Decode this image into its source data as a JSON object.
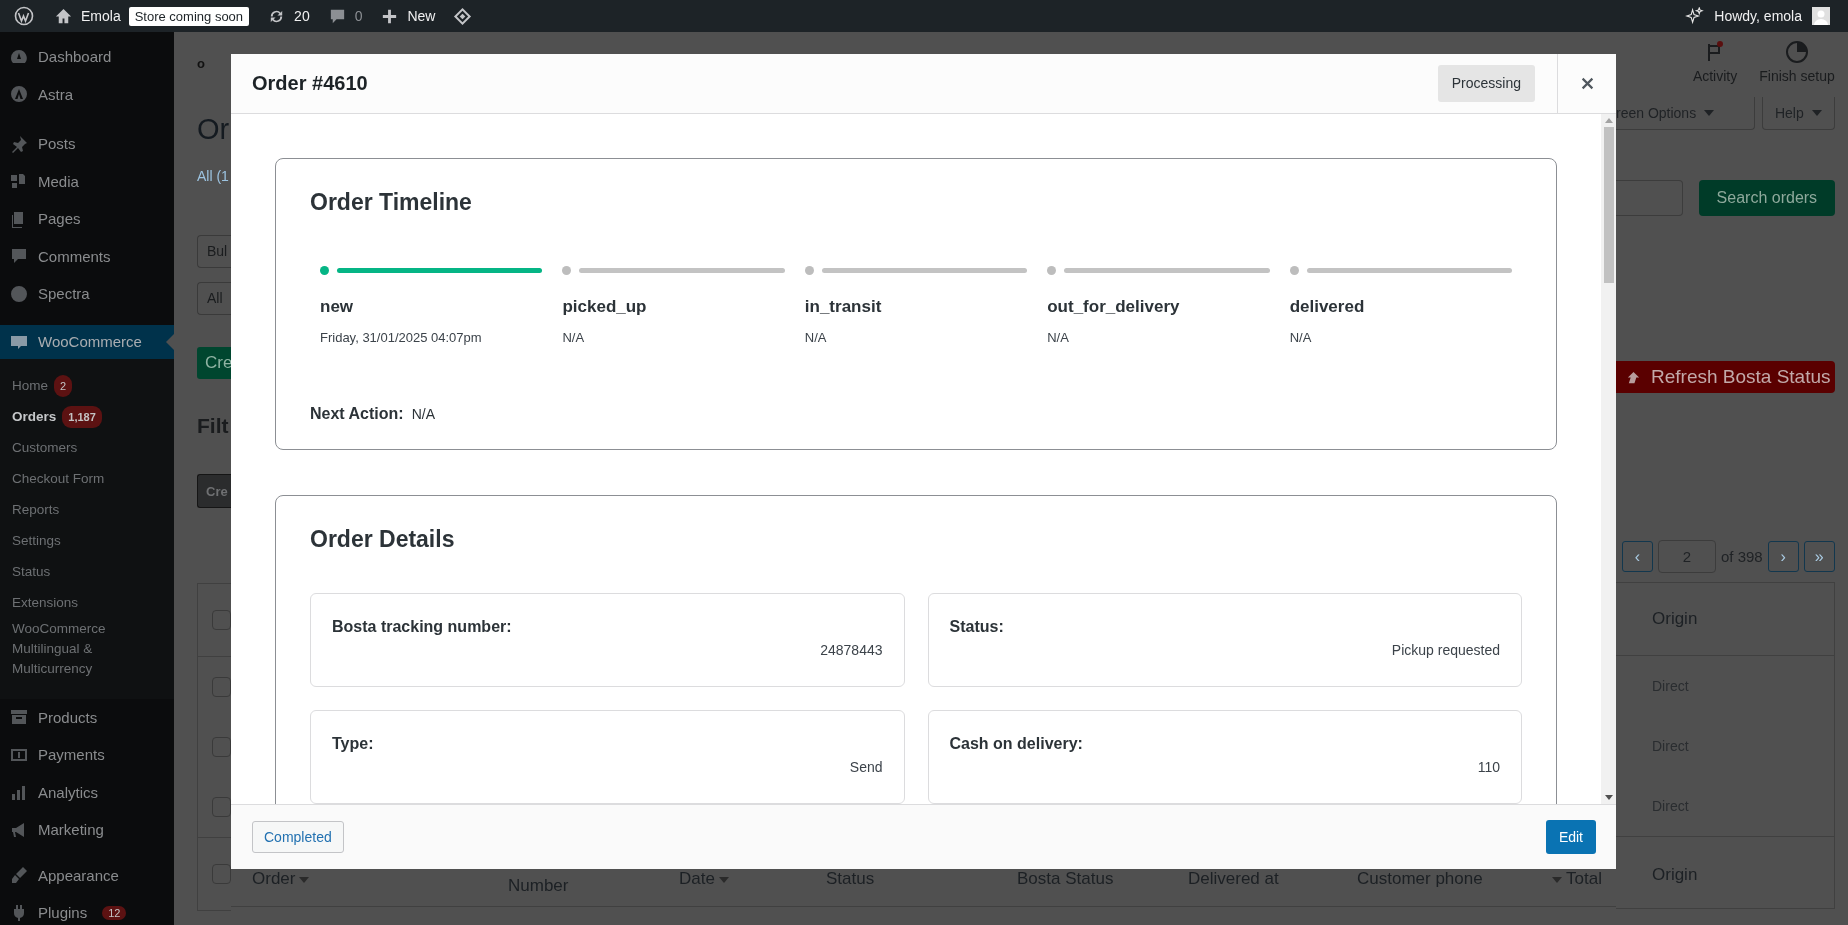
{
  "admin_bar": {
    "site_name": "Emola",
    "site_badge": "Store coming soon",
    "updates_count": "20",
    "comments_count": "0",
    "new_label": "New",
    "greeting": "Howdy, emola"
  },
  "sidebar": {
    "groups": [
      {
        "items": [
          {
            "label": "Dashboard",
            "selected": false
          },
          {
            "label": "Astra",
            "selected": false
          }
        ]
      },
      {
        "items": [
          {
            "label": "Posts",
            "selected": false
          },
          {
            "label": "Media",
            "selected": false
          },
          {
            "label": "Pages",
            "selected": false
          },
          {
            "label": "Comments",
            "selected": false
          },
          {
            "label": "Spectra",
            "selected": false
          }
        ]
      },
      {
        "items": [
          {
            "label": "WooCommerce",
            "selected": true,
            "children": [
              {
                "label": "Home",
                "badge": "2",
                "selected": false
              },
              {
                "label": "Orders",
                "badge": "1,187",
                "selected": true
              },
              {
                "label": "Customers",
                "selected": false
              },
              {
                "label": "Checkout Form",
                "selected": false
              },
              {
                "label": "Reports",
                "selected": false
              },
              {
                "label": "Settings",
                "selected": false
              },
              {
                "label": "Status",
                "selected": false
              },
              {
                "label": "Extensions",
                "selected": false
              },
              {
                "label": "WooCommerce Multilingual & Multicurrency",
                "selected": false
              }
            ]
          }
        ]
      },
      {
        "items": [
          {
            "label": "Products",
            "selected": false
          },
          {
            "label": "Payments",
            "selected": false
          },
          {
            "label": "Analytics",
            "selected": false
          },
          {
            "label": "Marketing",
            "selected": false
          }
        ]
      },
      {
        "items": [
          {
            "label": "Appearance",
            "selected": false
          },
          {
            "label": "Plugins",
            "badge": "12",
            "selected": false
          }
        ]
      }
    ]
  },
  "page": {
    "header_fragment": "o",
    "title_fragment": "Or",
    "views_fragment": "All (1",
    "bulk_select_fragment": "Bul",
    "date_select_fragment": "All",
    "create_button_fragment": "Cre",
    "filters_heading_fragment": "Filt",
    "filter_button_fragment": "Cre",
    "activity_label": "Activity",
    "finish_setup_label": "Finish setup",
    "screen_options_fragment": "reen Options",
    "help_label": "Help",
    "search_button": "Search orders",
    "refresh_button": "Refresh Bosta Status",
    "pagination": {
      "prev": "‹",
      "page": "2",
      "total": "of 398",
      "next": "›",
      "last": "»"
    },
    "table": {
      "header_checked": false,
      "footer_checked": false,
      "header_origin": "Origin",
      "rows": [
        {
          "checked": false,
          "origin": "Direct"
        },
        {
          "checked": false,
          "origin": "Direct"
        },
        {
          "checked": false,
          "origin": "Direct"
        }
      ],
      "footer_columns": [
        {
          "label": "Order",
          "sortable": true
        },
        {
          "label": "Number",
          "sortable": false
        },
        {
          "label": "Date",
          "sortable": true
        },
        {
          "label": "Status",
          "sortable": false
        },
        {
          "label": "Bosta Status",
          "sortable": false
        },
        {
          "label": "Delivered at",
          "sortable": false
        },
        {
          "label": "Customer phone",
          "sortable": false
        },
        {
          "label": "Total",
          "sortable": true
        },
        {
          "label": "Origin",
          "sortable": false
        }
      ]
    }
  },
  "modal": {
    "title": "Order #4610",
    "status": "Processing",
    "timeline": {
      "title": "Order Timeline",
      "steps": [
        {
          "label": "new",
          "date": "Friday, 31/01/2025 04:07pm",
          "done": true
        },
        {
          "label": "picked_up",
          "date": "N/A",
          "done": false
        },
        {
          "label": "in_transit",
          "date": "N/A",
          "done": false
        },
        {
          "label": "out_for_delivery",
          "date": "N/A",
          "done": false
        },
        {
          "label": "delivered",
          "date": "N/A",
          "done": false
        }
      ],
      "next_action_label": "Next Action:",
      "next_action": "N/A"
    },
    "details": {
      "title": "Order Details",
      "fields": [
        {
          "label": "Bosta tracking number:",
          "value": "24878443"
        },
        {
          "label": "Status:",
          "value": "Pickup requested"
        },
        {
          "label": "Type:",
          "value": "Send"
        },
        {
          "label": "Cash on delivery:",
          "value": "110"
        }
      ]
    },
    "footer": {
      "secondary_button": "Completed",
      "primary_button": "Edit"
    }
  }
}
